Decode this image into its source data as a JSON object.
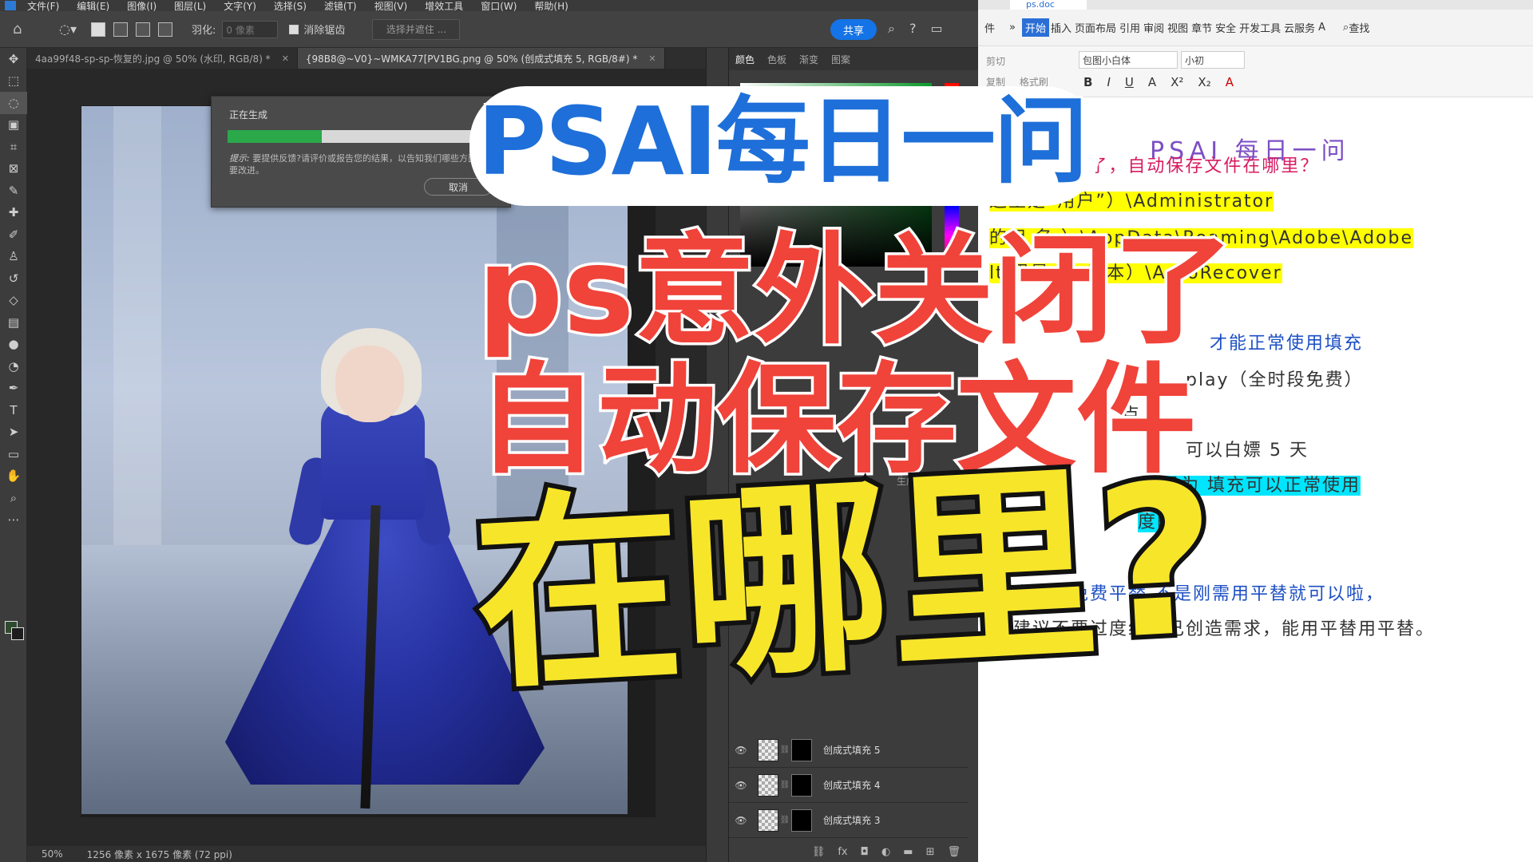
{
  "photoshop": {
    "menu": [
      "文件(F)",
      "编辑(E)",
      "图像(I)",
      "图层(L)",
      "文字(Y)",
      "选择(S)",
      "滤镜(T)",
      "视图(V)",
      "增效工具",
      "窗口(W)",
      "帮助(H)"
    ],
    "options": {
      "feather_label": "羽化:",
      "feather_placeholder": "0 像素",
      "antialias_label": "消除锯齿",
      "select_mask_label": "选择并遮住 ...",
      "share_label": "共享"
    },
    "tabs": [
      {
        "label": "4aa99f48-sp-sp-恢复的.jpg @ 50% (水印, RGB/8) *"
      },
      {
        "label": "{98B8@~V0}~WMKA77[PV1BG.png @ 50% (创成式填充 5, RGB/8#) *"
      }
    ],
    "generating_dialog": {
      "title": "正在生成",
      "progress": 0.37,
      "tip_prefix": "提示:",
      "tip_text": "要提供反馈?请评价或报告您的结果，以告知我们哪些方面需要改进。",
      "cancel_label": "取消"
    },
    "status": {
      "zoom": "50%",
      "doc_info": "1256 像素 x 1675 像素 (72 ppi)"
    },
    "panel_tabs": [
      "颜色",
      "色板",
      "渐变",
      "图案"
    ],
    "generate_badge": "生成",
    "layers": [
      {
        "name": "创成式填充 5"
      },
      {
        "name": "创成式填充 4"
      },
      {
        "name": "创成式填充 3"
      }
    ],
    "colors": {
      "accent": "#1473e6",
      "progress": "#2aa84a"
    }
  },
  "wps": {
    "file_tab": "ps.doc",
    "ribbon_tabs": [
      "件",
      "»",
      "开始",
      "插入",
      "页面布局",
      "引用",
      "审阅",
      "视图",
      "章节",
      "安全",
      "开发工具",
      "云服务",
      "A"
    ],
    "find_label": "查找",
    "font_name": "包图小白体",
    "font_size": "小初",
    "paste_labels": {
      "cut": "剪切",
      "copy": "复制",
      "format_painter": "格式刷"
    },
    "format_buttons": [
      "B",
      "I",
      "U",
      "A",
      "X²",
      "X₂",
      "A"
    ],
    "doc_title": "PSAI 每日一问",
    "doc_lines": [
      "问 ps 关闭了，自动保存文件在哪里？",
      "这里是“用户”）\\Administrator",
      "的用 名 ）\\AppData\\Roaming\\Adobe\\Adobe",
      "lt 里是 ps 版本）\\AutoRecover",
      "才能正常使用填充",
      "play（全时段免费）",
      "点",
      "可以白嫖 5 天",
      "只是为 填充可以正常使用",
      "度的",
      "群内也有免费平替 不是刚需用平替就可以啦，",
      "我建议不要过度给自己创造需求，能用平替用平替。"
    ]
  },
  "overlay": {
    "line1": "PSAI每日一问",
    "line2": "ps意外关闭了",
    "line3": "自动保存文件",
    "line4": "在哪里?",
    "colors": {
      "blue": "#1e6fd9",
      "red": "#f0433a",
      "yellow": "#f7e52a"
    }
  }
}
